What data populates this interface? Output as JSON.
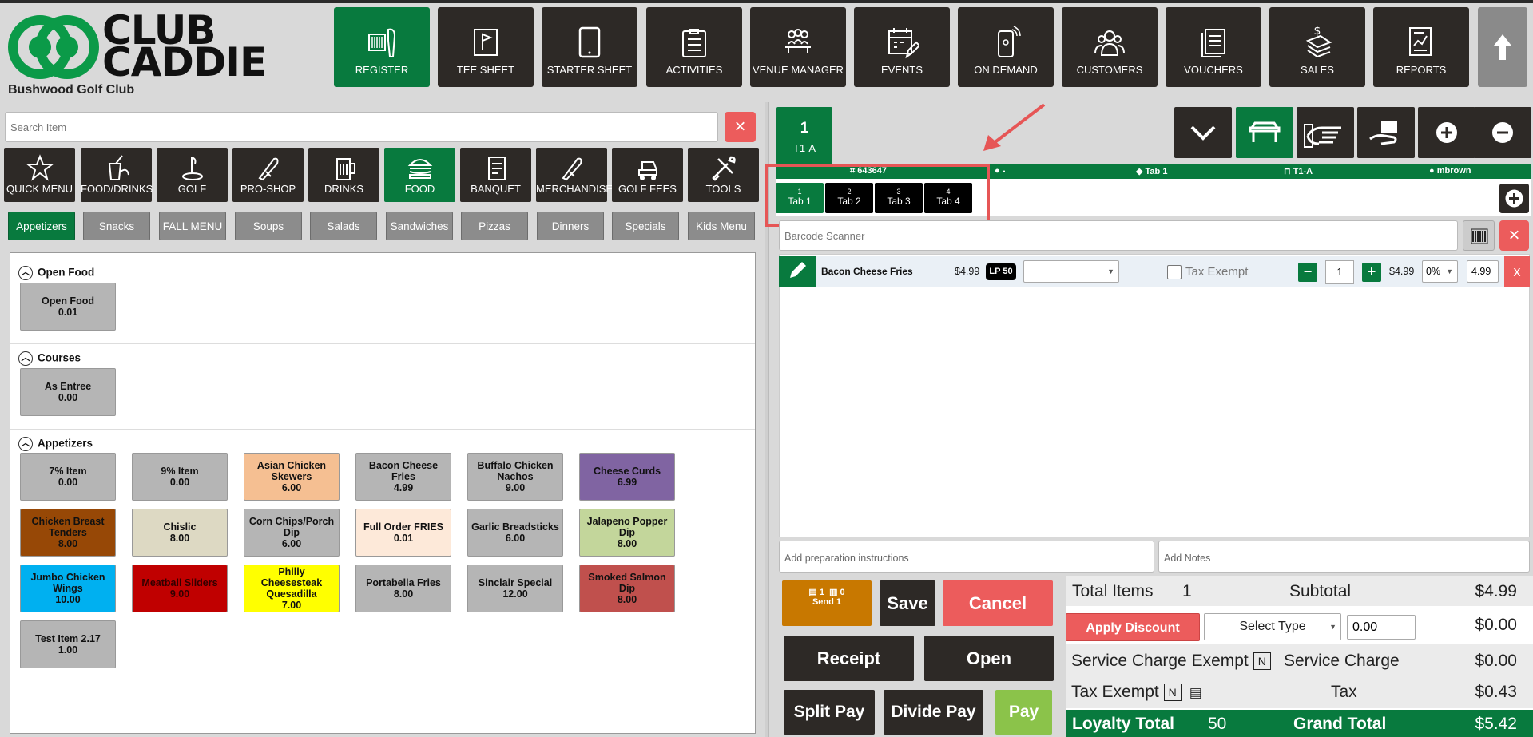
{
  "brand": {
    "logo_line1": "CLUB",
    "logo_line2": "CADDIE",
    "club_name": "Bushwood Golf Club"
  },
  "nav": [
    {
      "label": "REGISTER",
      "icon": "barcode-scanner-icon",
      "active": true
    },
    {
      "label": "TEE SHEET",
      "icon": "golf-flag-icon"
    },
    {
      "label": "STARTER SHEET",
      "icon": "tablet-icon"
    },
    {
      "label": "ACTIVITIES",
      "icon": "clipboard-list-icon"
    },
    {
      "label": "VENUE MANAGER",
      "icon": "meeting-table-icon"
    },
    {
      "label": "EVENTS",
      "icon": "calendar-edit-icon"
    },
    {
      "label": "ON DEMAND",
      "icon": "mobile-phone-icon"
    },
    {
      "label": "CUSTOMERS",
      "icon": "users-icon"
    },
    {
      "label": "VOUCHERS",
      "icon": "voucher-stack-icon"
    },
    {
      "label": "SALES",
      "icon": "money-stack-icon"
    },
    {
      "label": "REPORTS",
      "icon": "report-chart-icon"
    }
  ],
  "search": {
    "placeholder": "Search Item",
    "clear": "×"
  },
  "categories": [
    {
      "label": "QUICK MENU"
    },
    {
      "label": "FOOD/DRINKS"
    },
    {
      "label": "GOLF"
    },
    {
      "label": "PRO-SHOP"
    },
    {
      "label": "DRINKS"
    },
    {
      "label": "FOOD",
      "active": true
    },
    {
      "label": "BANQUET"
    },
    {
      "label": "MERCHANDISE"
    },
    {
      "label": "GOLF FEES"
    },
    {
      "label": "TOOLS"
    }
  ],
  "subcategories": [
    {
      "label": "Appetizers",
      "active": true
    },
    {
      "label": "Snacks"
    },
    {
      "label": "FALL MENU"
    },
    {
      "label": "Soups"
    },
    {
      "label": "Salads"
    },
    {
      "label": "Sandwiches"
    },
    {
      "label": "Pizzas"
    },
    {
      "label": "Dinners"
    },
    {
      "label": "Specials"
    },
    {
      "label": "Kids Menu"
    }
  ],
  "sections": [
    {
      "title": "Open Food",
      "items": [
        {
          "name": "Open Food",
          "price": "0.01",
          "color": "#b5b5b5"
        }
      ]
    },
    {
      "title": "Courses",
      "items": [
        {
          "name": "As Entree",
          "price": "0.00",
          "color": "#b5b5b5"
        }
      ]
    },
    {
      "title": "Appetizers",
      "items": [
        {
          "name": "7% Item",
          "price": "0.00",
          "color": "#b5b5b5"
        },
        {
          "name": "9% Item",
          "price": "0.00",
          "color": "#b5b5b5"
        },
        {
          "name": "Asian Chicken Skewers",
          "price": "6.00",
          "color": "#f5bf92"
        },
        {
          "name": "Bacon Cheese Fries",
          "price": "4.99",
          "color": "#b5b5b5"
        },
        {
          "name": "Buffalo Chicken Nachos",
          "price": "9.00",
          "color": "#b5b5b5"
        },
        {
          "name": "Cheese Curds",
          "price": "6.99",
          "color": "#8064a2"
        },
        {
          "name": "Chicken Breast Tenders",
          "price": "8.00",
          "color": "#974806"
        },
        {
          "name": "Chislic",
          "price": "8.00",
          "color": "#ddd9c3"
        },
        {
          "name": "Corn Chips/Porch Dip",
          "price": "6.00",
          "color": "#b5b5b5"
        },
        {
          "name": "Full Order FRIES",
          "price": "0.01",
          "color": "#fde9d9"
        },
        {
          "name": "Garlic Breadsticks",
          "price": "6.00",
          "color": "#b5b5b5"
        },
        {
          "name": "Jalapeno Popper Dip",
          "price": "8.00",
          "color": "#c3d69b"
        },
        {
          "name": "Jumbo Chicken Wings",
          "price": "10.00",
          "color": "#00b0f0"
        },
        {
          "name": "Meatball Sliders",
          "price": "9.00",
          "color": "#c00000"
        },
        {
          "name": "Philly Cheesesteak Quesadilla",
          "price": "7.00",
          "color": "#ffff00"
        },
        {
          "name": "Portabella Fries",
          "price": "8.00",
          "color": "#b5b5b5"
        },
        {
          "name": "Sinclair Special",
          "price": "12.00",
          "color": "#b5b5b5"
        },
        {
          "name": "Smoked Salmon Dip",
          "price": "8.00",
          "color": "#c0504d"
        },
        {
          "name": "Test Item 2.17",
          "price": "1.00",
          "color": "#b5b5b5"
        }
      ]
    }
  ],
  "order": {
    "table_number": "1",
    "table_name": "T1-A",
    "info": {
      "ticket": "643647",
      "customer": "-",
      "tab": "Tab 1",
      "table": "T1-A",
      "user": "mbrown"
    },
    "tabs": [
      {
        "num": "1",
        "label": "Tab 1",
        "active": true
      },
      {
        "num": "2",
        "label": "Tab 2"
      },
      {
        "num": "3",
        "label": "Tab 3"
      },
      {
        "num": "4",
        "label": "Tab 4"
      }
    ],
    "barcode_placeholder": "Barcode Scanner",
    "line": {
      "name": "Bacon Cheese Fries",
      "price": "$4.99",
      "lp": "LP",
      "lp_points": "50",
      "tax_exempt": "Tax Exempt",
      "qty": "1",
      "total": "$4.99",
      "discount": "0%",
      "net": "4.99",
      "remove": "x"
    },
    "prep_placeholder": "Add preparation instructions",
    "notes_placeholder": "Add Notes"
  },
  "actions": {
    "send_count_a": "1",
    "send_count_b": "0",
    "send_label": "Send 1",
    "save": "Save",
    "cancel": "Cancel",
    "receipt": "Receipt",
    "open": "Open",
    "split_pay": "Split Pay",
    "divide_pay": "Divide Pay",
    "pay": "Pay"
  },
  "summary": {
    "total_items_label": "Total Items",
    "total_items": "1",
    "subtotal_label": "Subtotal",
    "subtotal": "$4.99",
    "apply_discount": "Apply Discount",
    "select_type": "Select Type",
    "discount_value": "0.00",
    "discount_amount": "$0.00",
    "service_exempt_label": "Service Charge Exempt",
    "service_exempt_flag": "N",
    "service_charge_label": "Service Charge",
    "service_charge": "$0.00",
    "tax_exempt_label": "Tax Exempt",
    "tax_exempt_flag": "N",
    "tax_label": "Tax",
    "tax": "$0.43",
    "loyalty_label": "Loyalty Total",
    "loyalty": "50",
    "grand_label": "Grand Total",
    "grand_total": "$5.42"
  }
}
